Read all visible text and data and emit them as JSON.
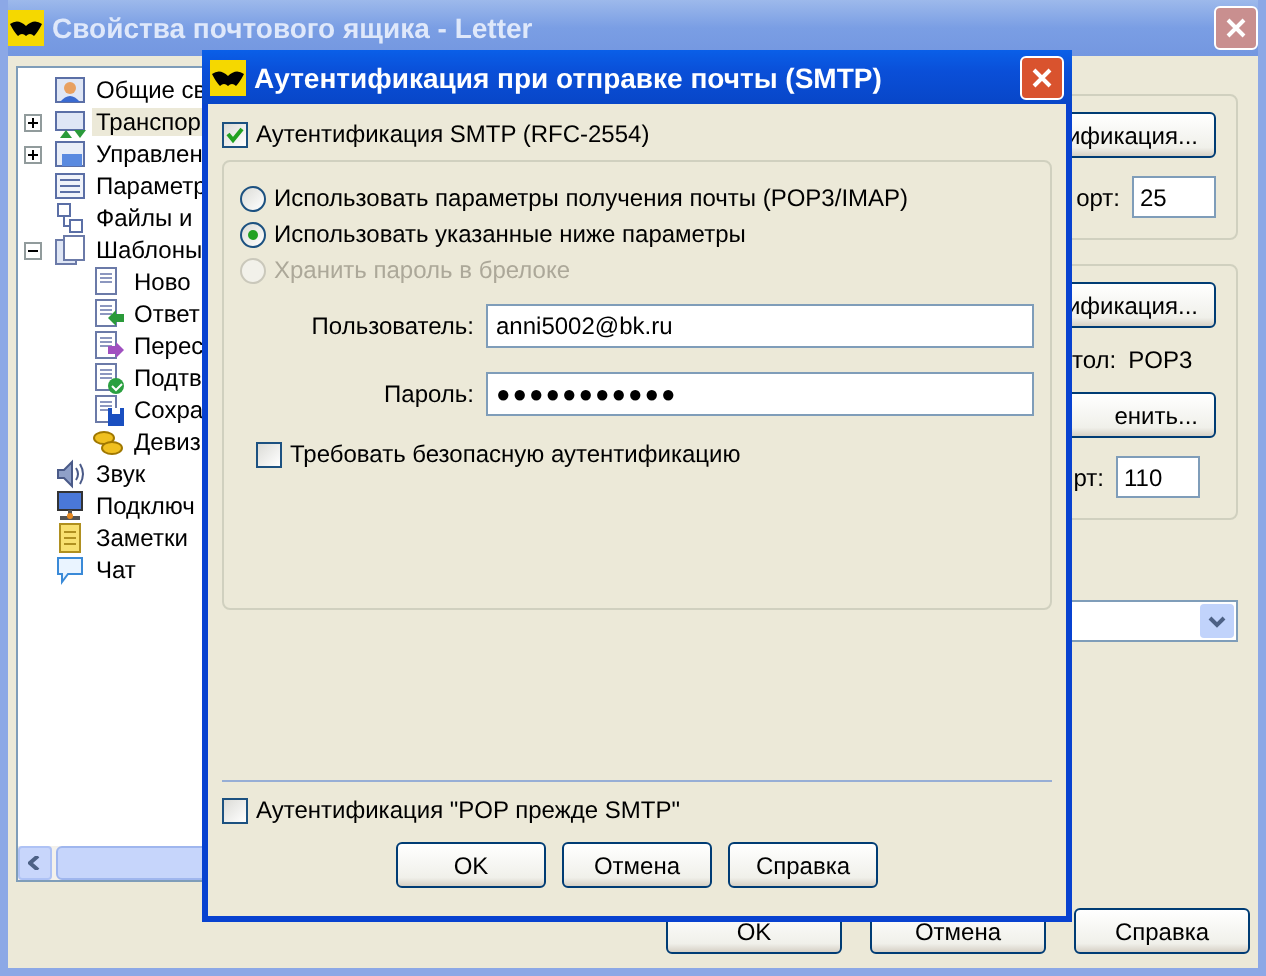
{
  "window": {
    "title": "Свойства почтового ящика - Letter"
  },
  "tree": [
    {
      "label": "Общие св",
      "selected": false
    },
    {
      "label": "Транспор",
      "selected": true,
      "expanded": false
    },
    {
      "label": "Управлен",
      "selected": false,
      "expanded": false
    },
    {
      "label": "Параметр",
      "selected": false
    },
    {
      "label": "Файлы и",
      "selected": false
    },
    {
      "label": "Шаблоны",
      "selected": false,
      "expanded": true,
      "children": [
        {
          "label": "Ново",
          "selected": false
        },
        {
          "label": "Ответ",
          "selected": false
        },
        {
          "label": "Перес",
          "selected": false
        },
        {
          "label": "Подтв",
          "selected": false
        },
        {
          "label": "Сохра",
          "selected": false
        },
        {
          "label": "Девиз",
          "selected": false
        }
      ]
    },
    {
      "label": "Звук",
      "selected": false
    },
    {
      "label": "Подключ",
      "selected": false
    },
    {
      "label": "Заметки",
      "selected": false
    },
    {
      "label": "Чат",
      "selected": false
    }
  ],
  "right_panel": {
    "group_1": {
      "button": "ификация...",
      "port_label": "орт:",
      "port_value": "25"
    },
    "group_2": {
      "button": "ификация...",
      "protocol_label": "тол:",
      "protocol_value": "POP3",
      "change_button": "енить...",
      "port_label": "рт:",
      "port_value": "110"
    }
  },
  "buttons": [
    "OK",
    "Отмена",
    "Справка"
  ],
  "dialog": {
    "title": "Аутентификация при отправке почты (SMTP)",
    "smtp_auth": {
      "label": "Аутентификация SMTP (RFC-2554)",
      "checked": true
    },
    "mode_options": [
      {
        "label": "Использовать параметры получения почты (POP3/IMAP)",
        "selected": false,
        "disabled": false
      },
      {
        "label": "Использовать указанные ниже параметры",
        "selected": true,
        "disabled": false
      },
      {
        "label": "Хранить пароль в брелоке",
        "selected": false,
        "disabled": true
      }
    ],
    "user": {
      "label": "Пользователь:",
      "value": "anni5002@bk.ru"
    },
    "password": {
      "label": "Пароль:",
      "value": "●●●●●●●●●●●"
    },
    "secure_auth": {
      "label": "Требовать безопасную аутентификацию",
      "checked": false
    },
    "pop_before_smtp": {
      "label": "Аутентификация \"POP прежде SMTP\"",
      "checked": false
    },
    "buttons": [
      "OK",
      "Отмена",
      "Справка"
    ]
  }
}
